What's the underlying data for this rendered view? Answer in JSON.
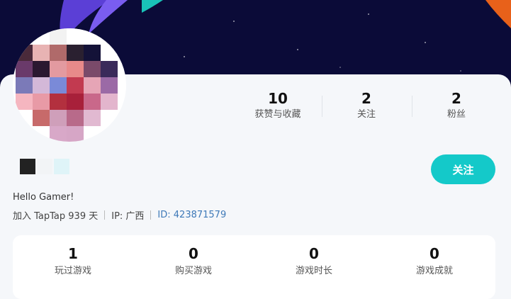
{
  "banner": {
    "colors": {
      "bg": "#0b0b38",
      "accent_purple": "#5b3fd6",
      "accent_teal": "#19c2b8",
      "accent_orange": "#e8611a"
    }
  },
  "profile": {
    "stats": [
      {
        "value": "10",
        "label": "获赞与收藏"
      },
      {
        "value": "2",
        "label": "关注"
      },
      {
        "value": "2",
        "label": "粉丝"
      }
    ],
    "follow_label": "关注",
    "bio": "Hello Gamer!",
    "joined": "加入 TapTap 939 天",
    "ip": "IP: 广西",
    "uid": "ID: 423871579"
  },
  "games": {
    "stats": [
      {
        "value": "1",
        "label": "玩过游戏"
      },
      {
        "value": "0",
        "label": "购买游戏"
      },
      {
        "value": "0",
        "label": "游戏时长"
      },
      {
        "value": "0",
        "label": "游戏成就"
      }
    ]
  },
  "colors": {
    "accent": "#14c9c9",
    "link": "#3e79b8"
  }
}
